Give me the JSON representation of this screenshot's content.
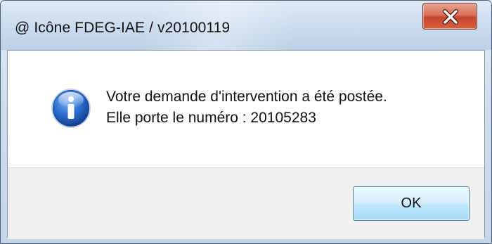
{
  "window": {
    "title": "@ Icône FDEG-IAE / v20100119",
    "close_icon": "close-x-icon"
  },
  "message": {
    "icon": "information-icon",
    "line1": "Votre demande d'intervention a été postée.",
    "line2": "Elle porte le numéro : 20105283"
  },
  "buttons": {
    "ok_label": "OK"
  },
  "colors": {
    "close_button": "#c7452b",
    "info_icon": "#2b6fd1",
    "ok_border": "#3c7fb1"
  }
}
